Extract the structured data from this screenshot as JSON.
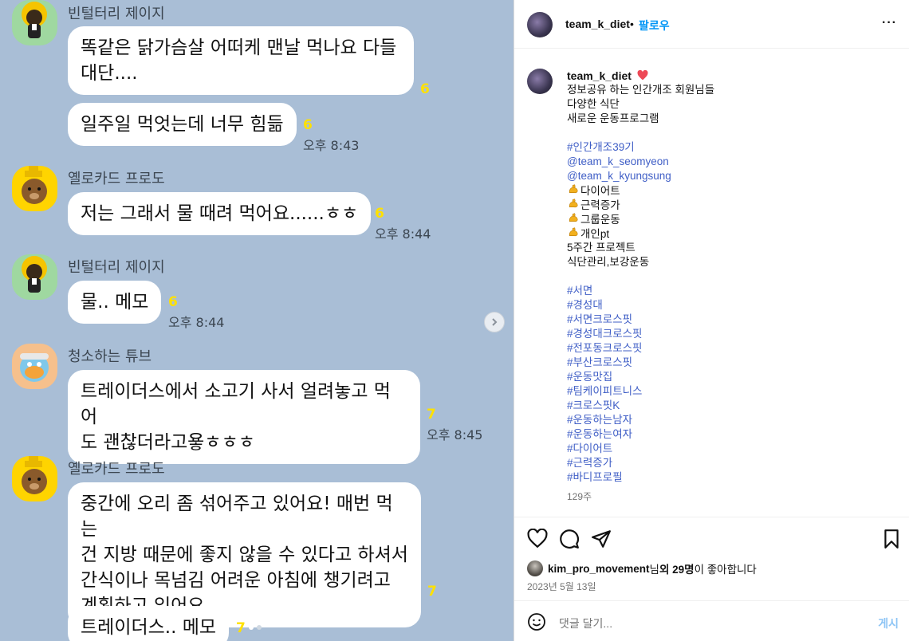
{
  "chat": {
    "messages": [
      {
        "sender": "빈털터리 제이지",
        "avatar": "apeach-jay-g-icon",
        "bubbles": [
          {
            "lines": [
              "똑같은 닭가슴살 어떠케 맨날 먹나요 다들",
              "대단...."
            ],
            "unread": "6",
            "time": ""
          },
          {
            "lines": [
              "일주일 먹엇는데 너무 힘듦"
            ],
            "unread": "6",
            "time": "오후 8:43"
          }
        ]
      },
      {
        "sender": "옐로카드 프로도",
        "avatar": "frodo-dog-icon",
        "bubbles": [
          {
            "lines": [
              "저는 그래서 물 때려 먹어요......ㅎㅎ"
            ],
            "unread": "6",
            "time": "오후 8:44"
          }
        ]
      },
      {
        "sender": "빈털터리 제이지",
        "avatar": "apeach-jay-g-icon",
        "bubbles": [
          {
            "lines": [
              "물.. 메모"
            ],
            "unread": "6",
            "time": "오후 8:44"
          }
        ]
      },
      {
        "sender": "청소하는 튜브",
        "avatar": "tube-duck-icon",
        "bubbles": [
          {
            "lines": [
              "트레이더스에서 소고기 사서 얼려놓고 먹어",
              "도 괜찮더라고욯ㅎㅎㅎ"
            ],
            "unread": "7",
            "time": "오후 8:45"
          }
        ]
      },
      {
        "sender": "옐로카드 프로도",
        "avatar": "frodo-dog-icon",
        "bubbles": [
          {
            "lines": [
              "중간에 오리 좀 섞어주고 있어요! 매번 먹는",
              "건 지방 때문에 좋지 않을 수 있다고 하셔서",
              "간식이나 목넘김 어려운 아침에 챙기려고",
              "계획하고 있어요"
            ],
            "unread": "7",
            "time": ""
          },
          {
            "lines": [
              "트레이더스.. 메모"
            ],
            "unread": "7",
            "time": ""
          }
        ]
      }
    ]
  },
  "ig": {
    "header": {
      "username": "team_k_diet",
      "separator": "•",
      "follow": "팔로우",
      "more": "···"
    },
    "caption": {
      "username": "team_k_diet",
      "lines": [
        {
          "t": "정보공유 하는 인간개조 회원님들"
        },
        {
          "t": "다양한 식단"
        },
        {
          "t": "새로운 운동프로그램"
        },
        {
          "t": ""
        },
        {
          "t": "#인간개조39기",
          "k": "tag"
        },
        {
          "t": "@team_k_seomyeon",
          "k": "tag"
        },
        {
          "t": "@team_k_kyungsung",
          "k": "tag"
        },
        {
          "t": "다이어트",
          "k": "flex"
        },
        {
          "t": "근력증가",
          "k": "flex"
        },
        {
          "t": "그룹운동",
          "k": "flex"
        },
        {
          "t": "개인pt",
          "k": "flex"
        },
        {
          "t": "5주간 프로젝트"
        },
        {
          "t": "식단관리,보강운동"
        },
        {
          "t": ""
        },
        {
          "t": "#서면",
          "k": "tag"
        },
        {
          "t": "#경성대",
          "k": "tag"
        },
        {
          "t": "#서면크로스핏",
          "k": "tag"
        },
        {
          "t": "#경성대크로스핏",
          "k": "tag"
        },
        {
          "t": "#전포동크로스핏",
          "k": "tag"
        },
        {
          "t": "#부산크로스핏",
          "k": "tag"
        },
        {
          "t": "#운동맛집",
          "k": "tag"
        },
        {
          "t": "#팀케이피트니스",
          "k": "tag"
        },
        {
          "t": "#크로스핏K",
          "k": "tag"
        },
        {
          "t": "#운동하는남자",
          "k": "tag"
        },
        {
          "t": "#운동하는여자",
          "k": "tag"
        },
        {
          "t": "#다이어트",
          "k": "tag"
        },
        {
          "t": "#근력증가",
          "k": "tag"
        },
        {
          "t": "#바디프로필",
          "k": "tag"
        }
      ],
      "age": "129주"
    },
    "likes": {
      "user": "kim_pro_movement",
      "suffix1": "님 ",
      "count": "외 29명",
      "suffix2": "이 좋아합니다"
    },
    "date": "2023년 5월 13일",
    "comment": {
      "placeholder": "댓글 달기...",
      "post": "게시"
    },
    "colors": {
      "link": "#3f5ec6",
      "follow": "#0095f6",
      "heart": "#ed4956"
    }
  }
}
